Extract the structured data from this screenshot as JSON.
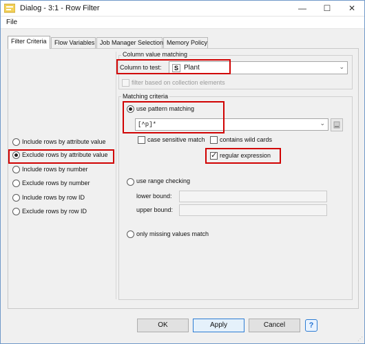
{
  "window": {
    "title": "Dialog - 3:1 - Row Filter"
  },
  "menu": {
    "file": "File"
  },
  "tabs": [
    "Filter Criteria",
    "Flow Variables",
    "Job Manager Selection",
    "Memory Policy"
  ],
  "filter_options": [
    {
      "label": "Include rows by attribute value",
      "selected": false
    },
    {
      "label": "Exclude rows by attribute value",
      "selected": true
    },
    {
      "label": "Include rows by number",
      "selected": false
    },
    {
      "label": "Exclude rows by number",
      "selected": false
    },
    {
      "label": "Include rows by row ID",
      "selected": false
    },
    {
      "label": "Exclude rows by row ID",
      "selected": false
    }
  ],
  "column_matching": {
    "group_title": "Column value matching",
    "column_label": "Column to test:",
    "column_type_badge": "S",
    "column_value": "Plant",
    "collection_label": "filter based on collection elements"
  },
  "matching_criteria": {
    "group_title": "Matching criteria",
    "pattern_label": "use pattern matching",
    "pattern_value": "[^p]*",
    "case_sensitive_label": "case sensitive match",
    "wildcards_label": "contains wild cards",
    "regex_label": "regular expression",
    "range_label": "use range checking",
    "lower_label": "lower bound:",
    "upper_label": "upper bound:",
    "missing_label": "only missing values match"
  },
  "buttons": {
    "ok": "OK",
    "apply": "Apply",
    "cancel": "Cancel",
    "help": "?"
  },
  "colors": {
    "highlight": "#d00000",
    "accent": "#2b7bd3"
  }
}
